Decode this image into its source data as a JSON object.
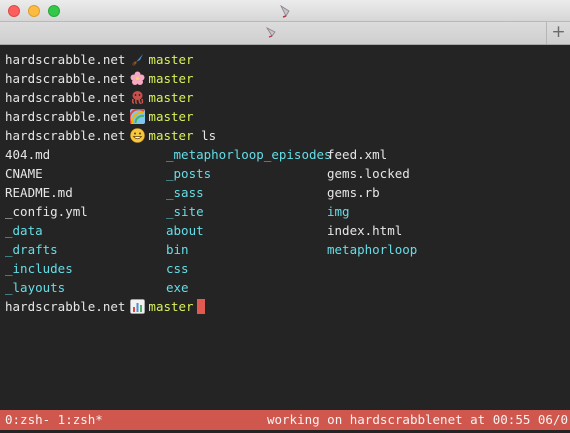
{
  "window": {
    "app_icon": "quill-pen-icon",
    "new_tab_label": "+"
  },
  "terminal": {
    "prompts": [
      {
        "host": "hardscrabble.net",
        "emoji": "paintbrush-icon",
        "branch": "master",
        "command": ""
      },
      {
        "host": "hardscrabble.net",
        "emoji": "cherry-blossom-icon",
        "branch": "master",
        "command": ""
      },
      {
        "host": "hardscrabble.net",
        "emoji": "octopus-icon",
        "branch": "master",
        "command": ""
      },
      {
        "host": "hardscrabble.net",
        "emoji": "rainbow-icon",
        "branch": "master",
        "command": ""
      },
      {
        "host": "hardscrabble.net",
        "emoji": "grinning-face-icon",
        "branch": "master",
        "command": "ls"
      }
    ],
    "ls_rows": [
      [
        {
          "name": "404.md",
          "type": "file"
        },
        {
          "name": "_metaphorloop_episodes",
          "type": "dir"
        },
        {
          "name": "feed.xml",
          "type": "file"
        }
      ],
      [
        {
          "name": "CNAME",
          "type": "file"
        },
        {
          "name": "_posts",
          "type": "dir"
        },
        {
          "name": "gems.locked",
          "type": "file"
        }
      ],
      [
        {
          "name": "README.md",
          "type": "file"
        },
        {
          "name": "_sass",
          "type": "dir"
        },
        {
          "name": "gems.rb",
          "type": "file"
        }
      ],
      [
        {
          "name": "_config.yml",
          "type": "file"
        },
        {
          "name": "_site",
          "type": "dir"
        },
        {
          "name": "img",
          "type": "dir"
        }
      ],
      [
        {
          "name": "_data",
          "type": "dir"
        },
        {
          "name": "about",
          "type": "dir"
        },
        {
          "name": "index.html",
          "type": "file"
        }
      ],
      [
        {
          "name": "_drafts",
          "type": "dir"
        },
        {
          "name": "bin",
          "type": "dir"
        },
        {
          "name": "metaphorloop",
          "type": "dir"
        }
      ],
      [
        {
          "name": "_includes",
          "type": "dir"
        },
        {
          "name": "css",
          "type": "dir"
        },
        null
      ],
      [
        {
          "name": "_layouts",
          "type": "dir"
        },
        {
          "name": "exe",
          "type": "dir"
        },
        null
      ]
    ],
    "final_prompt": {
      "host": "hardscrabble.net",
      "emoji": "bar-chart-icon",
      "branch": "master"
    }
  },
  "status_bar": {
    "left": "0:zsh- 1:zsh*",
    "right": "working on hardscrabblenet at 00:55 06/0"
  },
  "colors": {
    "background": "#242424",
    "branch": "#d8f25a",
    "directory": "#65dde6",
    "status_bar": "#d0574d",
    "cursor": "#e05a4f"
  }
}
